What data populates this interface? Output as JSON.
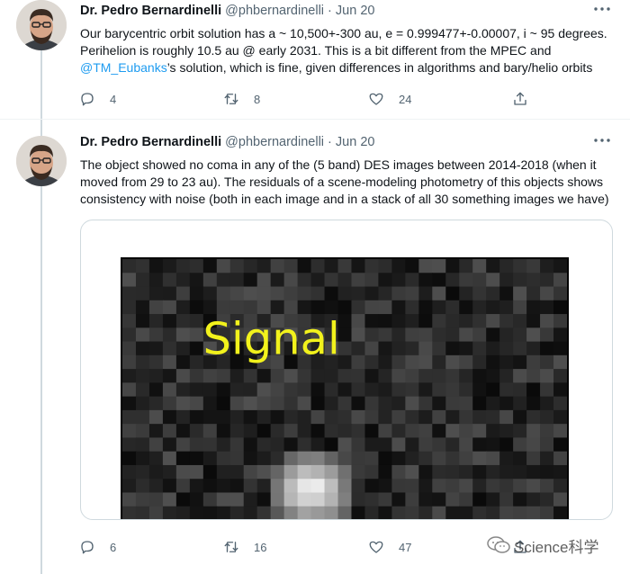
{
  "icons": {
    "reply": "reply-icon",
    "retweet": "retweet-icon",
    "like": "heart-icon",
    "share": "share-icon",
    "more": "more-options-icon"
  },
  "colors": {
    "link": "#1d9bf0",
    "muted_text": "#536471",
    "thread_line": "#cfd9de",
    "signal_label": "#f2f21c"
  },
  "tweets": [
    {
      "author_name": "Dr. Pedro Bernardinelli",
      "handle": "@phbernardinelli",
      "separator": "·",
      "date": "Jun 20",
      "text_lines": [
        "Our barycentric orbit solution has a ~ 10,500+-300 au, e = 0.999477+-0.00007, i ~ 95 degrees.",
        "Perihelion is roughly 10.5 au @ early 2031. This is a bit different from the MPEC and"
      ],
      "text_line3_mention": "@TM_Eubanks",
      "text_line3_rest": "’s solution, which is fine, given differences in algorithms and bary/helio orbits",
      "reply_count": "4",
      "retweet_count": "8",
      "like_count": "24"
    },
    {
      "author_name": "Dr. Pedro Bernardinelli",
      "handle": "@phbernardinelli",
      "separator": "·",
      "date": "Jun 20",
      "text_lines": [
        "The object showed no coma in any of the (5 band) DES images between 2014-2018 (when it",
        "moved from 29 to 23 au). The residuals of a scene-modeling photometry of this objects shows",
        "consistency with noise (both in each image and in a stack of all 30 something images we have)"
      ],
      "media_label": "Signal",
      "reply_count": "6",
      "retweet_count": "16",
      "like_count": "47"
    }
  ],
  "watermark": {
    "text": "Science科学"
  }
}
